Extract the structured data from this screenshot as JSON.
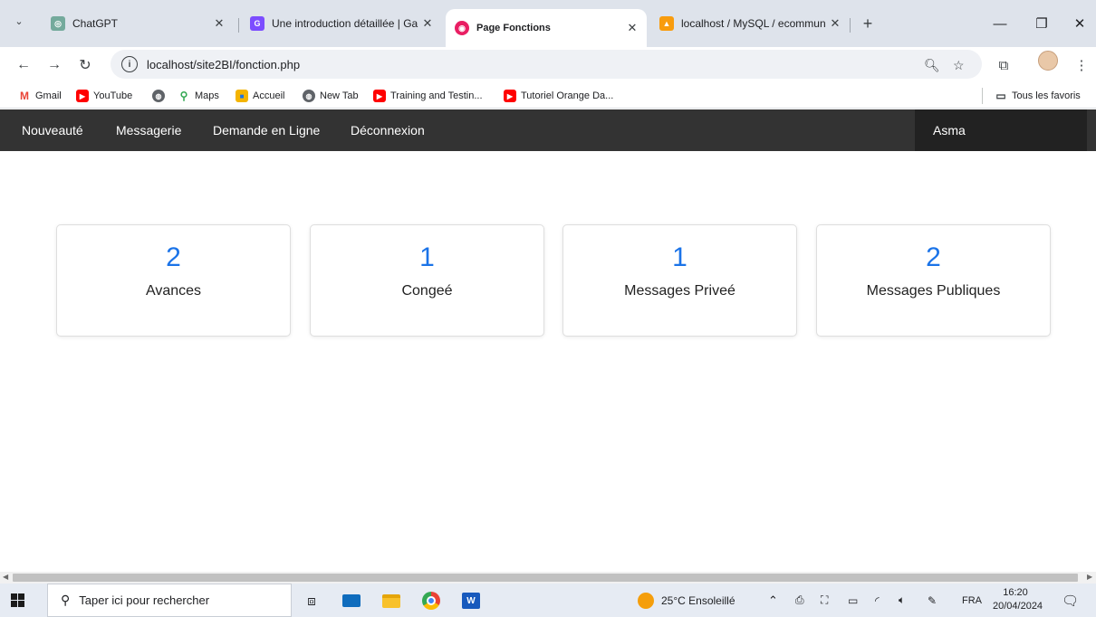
{
  "browser": {
    "tabs": [
      {
        "title": "ChatGPT",
        "icon": "chatgpt-icon",
        "active": false
      },
      {
        "title": "Une introduction détaillée | Ga",
        "icon": "site-icon",
        "active": false
      },
      {
        "title": "Page Fonctions",
        "icon": "site-icon",
        "active": true
      },
      {
        "title": "localhost / MySQL / ecommun",
        "icon": "phpmyadmin-icon",
        "active": false
      }
    ],
    "address": "localhost/site2BI/fonction.php",
    "bookmarks": [
      {
        "label": "Gmail",
        "icon": "gmail-icon"
      },
      {
        "label": "YouTube",
        "icon": "youtube-icon"
      },
      {
        "label": "",
        "icon": "globe-icon"
      },
      {
        "label": "Maps",
        "icon": "maps-icon"
      },
      {
        "label": "Accueil",
        "icon": "accueil-icon"
      },
      {
        "label": "New Tab",
        "icon": "globe-icon"
      },
      {
        "label": "Training and Testin...",
        "icon": "youtube-icon"
      },
      {
        "label": "Tutoriel Orange Da...",
        "icon": "youtube-icon"
      }
    ],
    "all_bookmarks": "Tous les favoris"
  },
  "page": {
    "nav": [
      "Nouveauté",
      "Messagerie",
      "Demande en Ligne",
      "Déconnexion"
    ],
    "user": "Asma",
    "cards": [
      {
        "count": "2",
        "label": "Avances"
      },
      {
        "count": "1",
        "label": "Congeé"
      },
      {
        "count": "1",
        "label": "Messages Priveé"
      },
      {
        "count": "2",
        "label": "Messages Publiques"
      }
    ],
    "accent_color": "#1a73e8",
    "nav_color": "#333333"
  },
  "taskbar": {
    "search_placeholder": "Taper ici pour rechercher",
    "weather": "25°C  Ensoleillé",
    "language": "FRA",
    "time": "16:20",
    "date": "20/04/2024"
  }
}
